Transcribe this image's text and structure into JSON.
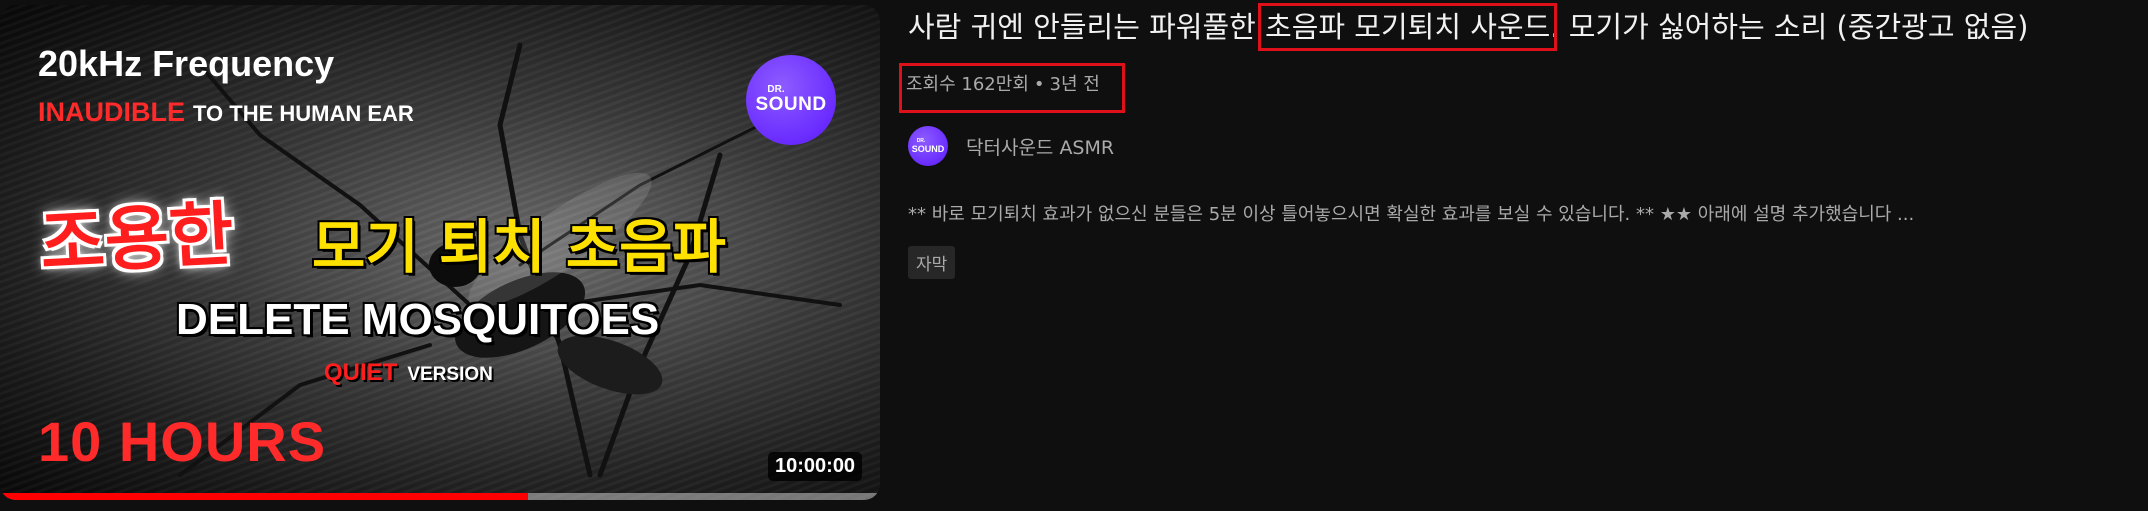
{
  "thumbnail": {
    "line_frequency": "20kHz Frequency",
    "line_inaudible_red": "INAUDIBLE",
    "line_inaudible_rest": "TO THE HUMAN EAR",
    "logo_small": "DR.",
    "logo_main": "SOUND",
    "kr_quiet": "조용한",
    "kr_mosquito": "모기 퇴치 초음파",
    "line_delete": "DELETE MOSQUITOES",
    "line_quiet_red": "QUIET",
    "line_quiet_rest": "VERSION",
    "line_hours": "10 HOURS",
    "duration": "10:00:00",
    "watch_progress": 0.6
  },
  "video": {
    "title_before": "사람 귀엔 안들리는 파워풀한 ",
    "title_highlight": "초음파 모기퇴치 사운드",
    "title_after": ". 모기가 싫어하는 소리 (중간광고 없음)",
    "views": "조회수 162만회",
    "separator": "•",
    "age": "3년 전",
    "channel_avatar_small": "DR.",
    "channel_avatar_main": "SOUND",
    "channel_name": "닥터사운드 ASMR",
    "description": "** 바로 모기퇴치 효과가 없으신 분들은 5분 이상 틀어놓으시면 확실한 효과를 보실 수 있습니다. ** ★★ 아래에 설명 추가했습니다 ...",
    "badge": "자막"
  },
  "colors": {
    "background": "#0f0f0f",
    "highlight_box": "#e0101a",
    "progress": "#ff0000",
    "brand_purple": "#6a2cff"
  }
}
